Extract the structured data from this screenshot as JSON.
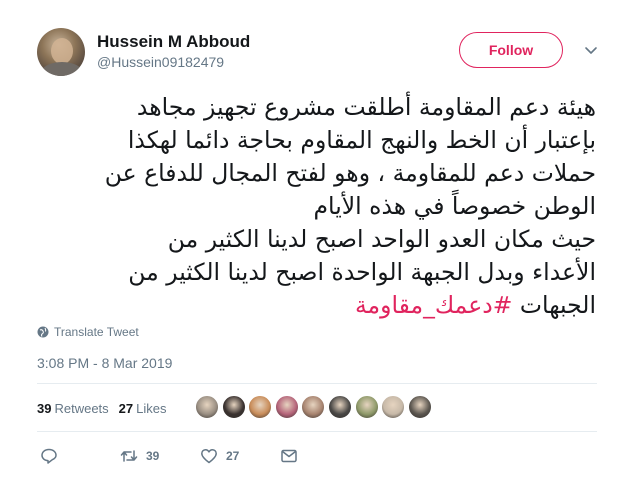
{
  "user": {
    "name": "Hussein M Abboud",
    "handle": "@Hussein09182479",
    "follow_label": "Follow",
    "avatar_icon": "profile-photo"
  },
  "tweet": {
    "lines": [
      "هيئة دعم المقاومة أطلقت مشروع تجهيز مجاهد",
      "بإعتبار أن الخط والنهج المقاوم بحاجة دائما لهكذا",
      "حملات دعم للمقاومة ، وهو لفتح المجال للدفاع عن",
      "الوطن خصوصاً في هذه الأيام",
      "حيث مكان العدو الواحد اصبح لدينا الكثير من",
      "الأعداء وبدل الجبهة الواحدة اصبح لدينا الكثير من",
      "الجبهات"
    ],
    "hashtag": "#دعمك_مقاومة",
    "translate_label": "Translate Tweet",
    "timestamp": "3:08 PM - 8 Mar 2019"
  },
  "stats": {
    "retweets_count": "39",
    "retweets_label": "Retweets",
    "likes_count": "27",
    "likes_label": "Likes",
    "liker_colors": [
      "#9a8f83",
      "#3a3230",
      "#c98d5a",
      "#b5647a",
      "#a88470",
      "#4a4846",
      "#8f9a6a",
      "#c7b9a8",
      "#5c5750"
    ]
  },
  "actions": {
    "reply_icon": "reply-icon",
    "retweet_icon": "retweet-icon",
    "retweet_count": "39",
    "like_icon": "heart-icon",
    "like_count": "27",
    "dm_icon": "envelope-icon"
  },
  "colors": {
    "accent": "#e0245e",
    "muted": "#657786",
    "text": "#14171a"
  }
}
